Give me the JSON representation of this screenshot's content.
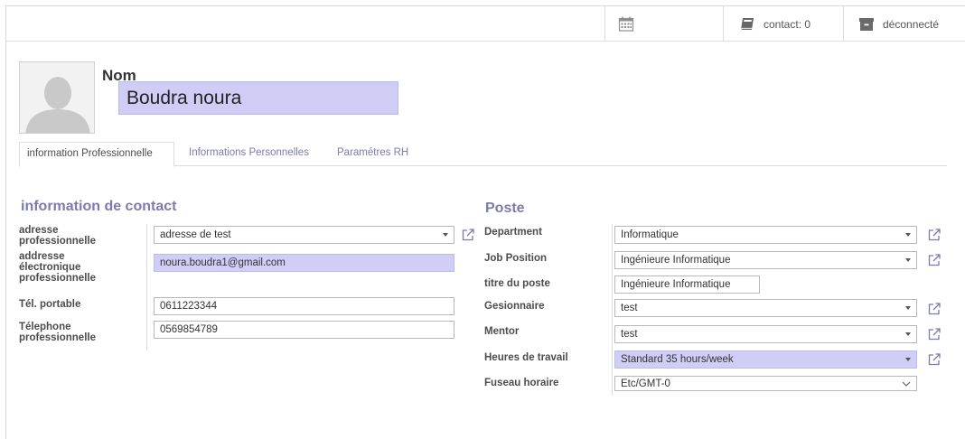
{
  "topbar": {
    "calendar_icon": "calendar-icon",
    "contact_label": "contact: 0",
    "contact_icon": "book-icon",
    "disconnect_label": "déconnecté",
    "disconnect_icon": "archive-icon"
  },
  "header": {
    "name_label": "Nom",
    "name_value": "Boudra noura"
  },
  "tabs": [
    {
      "label": "information Professionnelle",
      "active": true
    },
    {
      "label": "Informations Personnelles",
      "active": false
    },
    {
      "label": "Paramétres RH",
      "active": false
    }
  ],
  "contact": {
    "title": "information de contact",
    "address_label": "adresse professionnelle",
    "address_value": "adresse de test",
    "email_label": "addresse électronique professionnelle",
    "email_value": "noura.boudra1@gmail.com",
    "mobile_label": "Tél. portable",
    "mobile_value": "0611223344",
    "phone_label": "Télephone professionnelle",
    "phone_value": "0569854789"
  },
  "poste": {
    "title": "Poste",
    "department_label": "Department",
    "department_value": "Informatique",
    "job_position_label": "Job Position",
    "job_position_value": "Ingénieure Informatique",
    "job_title_label": "titre du poste",
    "job_title_value": "Ingénieure Informatique",
    "manager_label": "Gesionnaire",
    "manager_value": "test",
    "mentor_label": "Mentor",
    "mentor_value": "test",
    "hours_label": "Heures de travail",
    "hours_value": "Standard 35 hours/week",
    "timezone_label": "Fuseau horaire",
    "timezone_value": "Etc/GMT-0"
  },
  "colors": {
    "accent": "#7c7bad",
    "required_bg": "#d0cef7"
  }
}
